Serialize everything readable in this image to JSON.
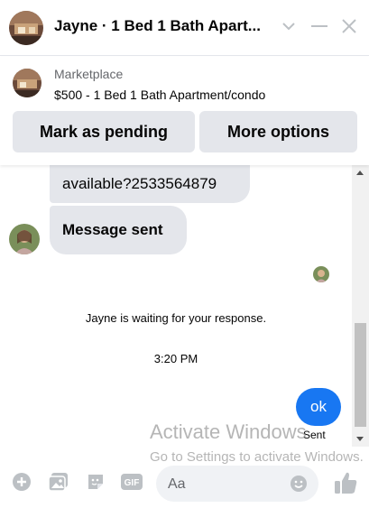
{
  "header": {
    "title": "Jayne · 1 Bed 1 Bath Apart...",
    "icons": [
      "chevron-down-icon",
      "minimize-icon",
      "close-icon"
    ]
  },
  "marketplace": {
    "label": "Marketplace",
    "listing": "$500 - 1 Bed 1 Bath Apartment/condo",
    "pending_button": "Mark as pending",
    "more_button": "More options"
  },
  "thread": {
    "messages": [
      {
        "from": "me",
        "text": "available?2533564879"
      },
      {
        "from": "peer",
        "text": "Message sent"
      }
    ],
    "waiting_notice": "Jayne is waiting for your response.",
    "timestamp": "3:20 PM",
    "reply": "ok",
    "status": "Sent"
  },
  "watermark": {
    "line1": "Activate Windows",
    "line2": "Go to Settings to activate Windows."
  },
  "composer": {
    "placeholder": "Aa",
    "icons": [
      "plus-icon",
      "photo-icon",
      "sticker-icon",
      "gif-icon",
      "emoji-icon",
      "thumbs-up-icon"
    ]
  },
  "colors": {
    "accent": "#1877f2",
    "bubble": "#e4e6eb",
    "icon": "#bcc0c4"
  }
}
